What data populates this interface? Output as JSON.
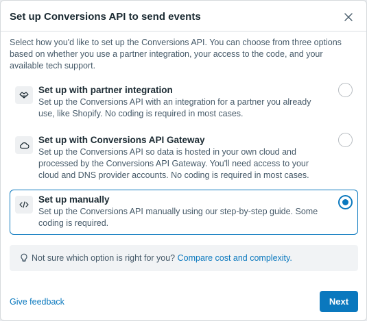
{
  "dialog": {
    "title": "Set up Conversions API to send events",
    "close_icon": "close-icon",
    "intro": "Select how you'd like to set up the Conversions API. You can choose from three options based on whether you use a partner integration, your access to the code, and your available tech support."
  },
  "options": [
    {
      "icon": "handshake-icon",
      "title": "Set up with partner integration",
      "description": "Set up the Conversions API with an integration for a partner you already use, like Shopify. No coding is required in most cases.",
      "selected": false
    },
    {
      "icon": "cloud-icon",
      "title": "Set up with Conversions API Gateway",
      "description": "Set up the Conversions API so data is hosted in your own cloud and processed by the Conversions API Gateway. You'll need access to your cloud and DNS provider accounts. No coding is required in most cases.",
      "selected": false
    },
    {
      "icon": "code-icon",
      "title": "Set up manually",
      "description": "Set up the Conversions API manually using our step-by-step guide. Some coding is required.",
      "selected": true
    }
  ],
  "hint": {
    "icon": "lightbulb-icon",
    "text": "Not sure which option is right for you?",
    "link": "Compare cost and complexity."
  },
  "footer": {
    "feedback_label": "Give feedback",
    "next_label": "Next"
  },
  "colors": {
    "accent": "#0a78be",
    "text": "#1c2b33",
    "muted_text": "#465a69"
  }
}
